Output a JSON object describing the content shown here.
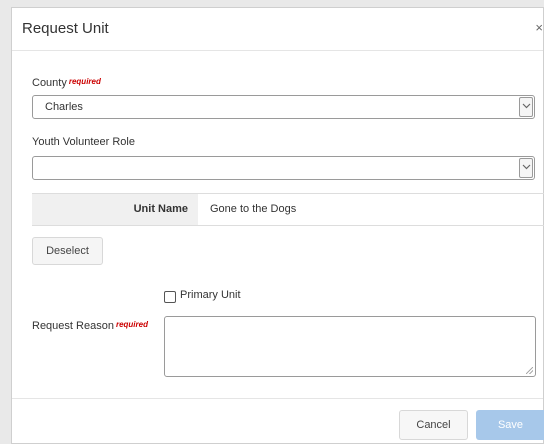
{
  "modal": {
    "title": "Request Unit",
    "close": "×"
  },
  "county": {
    "label": "County",
    "required": "required",
    "value": "Charles"
  },
  "role": {
    "label": "Youth Volunteer Role",
    "value": ""
  },
  "unit": {
    "label": "Unit Name",
    "value": "Gone to the Dogs"
  },
  "buttons": {
    "deselect": "Deselect",
    "cancel": "Cancel",
    "save": "Save"
  },
  "primary": {
    "label": "Primary Unit",
    "checked": false
  },
  "reason": {
    "label": "Request Reason",
    "required": "required",
    "value": ""
  },
  "colors": {
    "required": "#cc0000",
    "save_disabled": "#a7c8ea"
  }
}
